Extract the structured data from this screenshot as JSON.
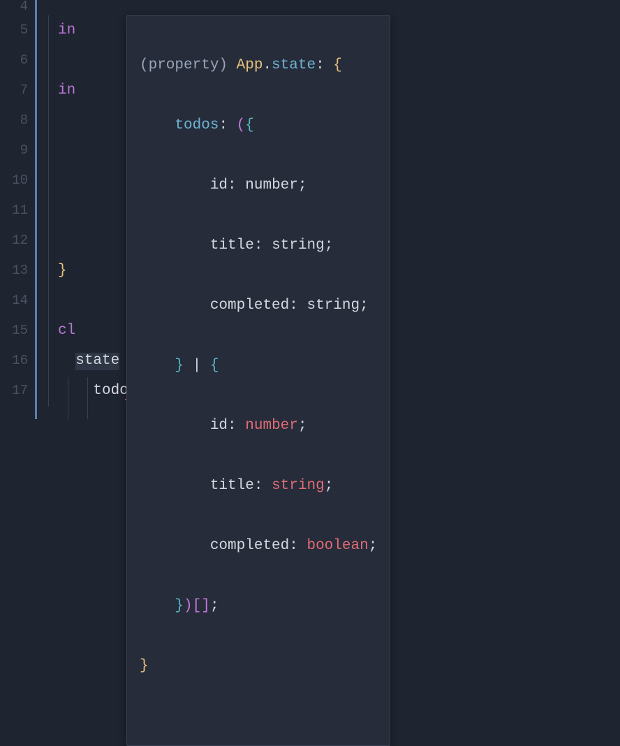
{
  "gutter": [
    "4",
    "5",
    "6",
    "7",
    "8",
    "9",
    "10",
    "11",
    "12",
    "13",
    "14",
    "15",
    "16",
    "17"
  ],
  "bg_code": {
    "line5_keyword": "in",
    "line7_keyword": "in",
    "line13_brace": "}",
    "line15_keyword": "cl",
    "line16_state": "state",
    "line16_eq": " = ",
    "line16_brace": "{",
    "line17_prop": "todos",
    "line17_colon": ": ",
    "line17_bracket": "["
  },
  "tooltip": {
    "l1_label": "(property) ",
    "l1_class": "App",
    "l1_dot": ".",
    "l1_prop": "state",
    "l1_colon": ": ",
    "l1_brace": "{",
    "l2_indent": "    ",
    "l2_prop": "todos",
    "l2_colon": ": ",
    "l2_paren": "(",
    "l2_brace": "{",
    "l3_indent": "        ",
    "l3_prop": "id",
    "l3_colon": ": ",
    "l3_type": "number",
    "l3_semi": ";",
    "l4_indent": "        ",
    "l4_prop": "title",
    "l4_colon": ": ",
    "l4_type": "string",
    "l4_semi": ";",
    "l5_indent": "        ",
    "l5_prop": "completed",
    "l5_colon": ": ",
    "l5_type": "string",
    "l5_semi": ";",
    "l6_indent": "    ",
    "l6_brace": "}",
    "l6_pipe": " | ",
    "l6_brace2": "{",
    "l7_indent": "        ",
    "l7_prop": "id",
    "l7_colon": ": ",
    "l7_type": "number",
    "l7_semi": ";",
    "l8_indent": "        ",
    "l8_prop": "title",
    "l8_colon": ": ",
    "l8_type": "string",
    "l8_semi": ";",
    "l9_indent": "        ",
    "l9_prop": "completed",
    "l9_colon": ": ",
    "l9_type": "boolean",
    "l9_semi": ";",
    "l10_indent": "    ",
    "l10_brace": "}",
    "l10_paren": ")",
    "l10_brackets": "[]",
    "l10_semi": ";",
    "l11_brace": "}"
  }
}
